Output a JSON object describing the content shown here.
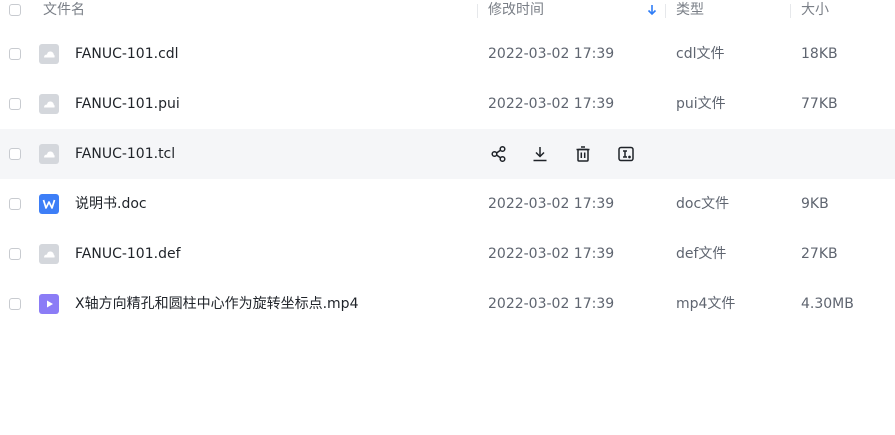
{
  "header": {
    "name_label": "文件名",
    "modified_label": "修改时间",
    "type_label": "类型",
    "size_label": "大小"
  },
  "files": [
    {
      "name": "FANUC-101.cdl",
      "date": "2022-03-02 17:39",
      "type": "cdl文件",
      "size": "18KB",
      "icon": "generic-file-icon"
    },
    {
      "name": "FANUC-101.pui",
      "date": "2022-03-02 17:39",
      "type": "pui文件",
      "size": "77KB",
      "icon": "generic-file-icon"
    },
    {
      "name": "FANUC-101.tcl",
      "date": "",
      "type": "",
      "size": "",
      "icon": "generic-file-icon",
      "hovered": true,
      "actions": [
        "share-icon",
        "download-icon",
        "delete-icon",
        "rename-icon"
      ]
    },
    {
      "name": "说明书.doc",
      "date": "2022-03-02 17:39",
      "type": "doc文件",
      "size": "9KB",
      "icon": "word-doc-icon"
    },
    {
      "name": "FANUC-101.def",
      "date": "2022-03-02 17:39",
      "type": "def文件",
      "size": "27KB",
      "icon": "generic-file-icon"
    },
    {
      "name": "X轴方向精孔和圆柱中心作为旋转坐标点.mp4",
      "date": "2022-03-02 17:39",
      "type": "mp4文件",
      "size": "4.30MB",
      "icon": "video-file-icon"
    }
  ],
  "colors": {
    "accent": "#2f7df6",
    "word_blue": "#3d7ef7",
    "video_purple": "#8b7cf6",
    "generic_gray": "#d4d7dc",
    "hover_bg": "#f5f6f8"
  }
}
